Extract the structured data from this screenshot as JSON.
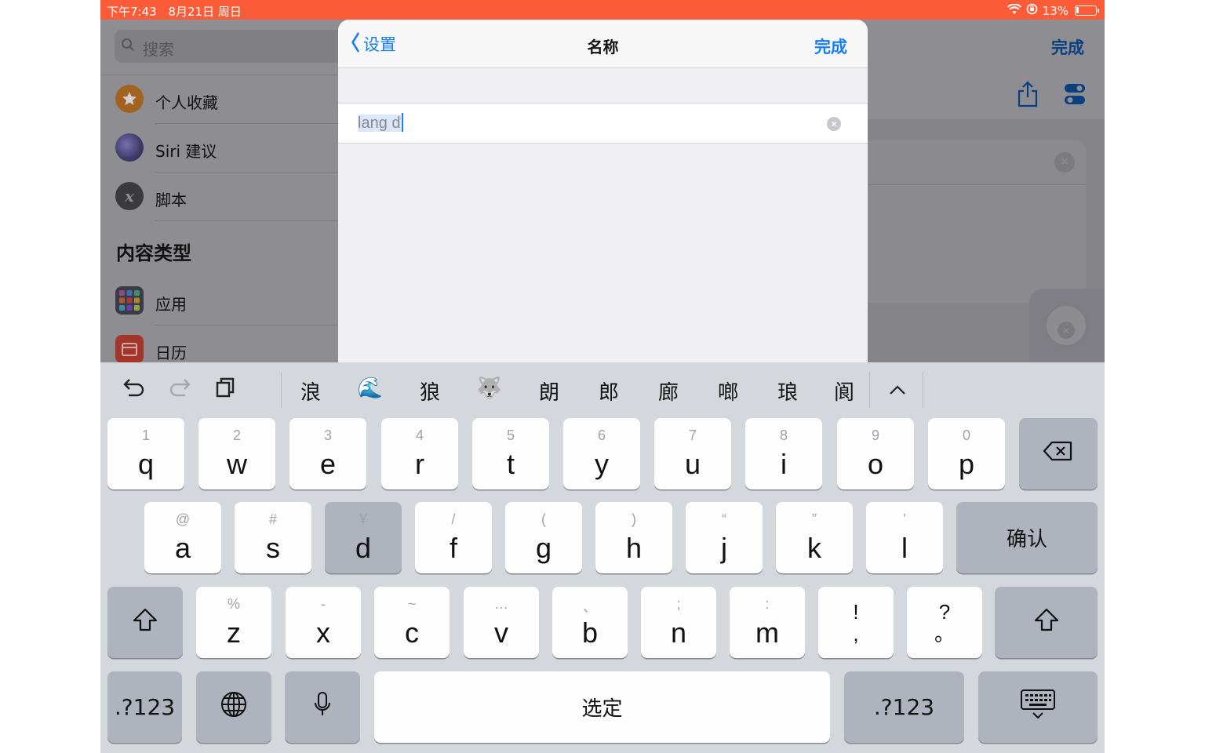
{
  "status_bar": {
    "time": "下午7:43",
    "date": "8月21日 周日",
    "battery": "13%",
    "battery_level": 0.13,
    "color": "#fc5b38"
  },
  "sidebar": {
    "search_placeholder": "搜索",
    "items": [
      {
        "label": "个人收藏",
        "icon": "star-icon"
      },
      {
        "label": "Siri 建议",
        "icon": "siri-icon"
      },
      {
        "label": "脚本",
        "icon": "script-x-icon"
      }
    ],
    "section_title": "内容类型",
    "content_items": [
      {
        "label": "应用",
        "icon": "apps-grid-icon"
      },
      {
        "label": "日历",
        "icon": "calendar-icon"
      }
    ]
  },
  "background": {
    "done_label": "完成"
  },
  "modal": {
    "back_label": "设置",
    "title": "名称",
    "done_label": "完成",
    "input_value": "lang d",
    "accent_color": "#157efb"
  },
  "keyboard": {
    "candidates": [
      "浪",
      "🌊",
      "狼",
      "🐺",
      "朗",
      "郎",
      "廊",
      "啷",
      "琅",
      "阆"
    ],
    "row1": [
      {
        "sub": "1",
        "main": "q"
      },
      {
        "sub": "2",
        "main": "w"
      },
      {
        "sub": "3",
        "main": "e"
      },
      {
        "sub": "4",
        "main": "r"
      },
      {
        "sub": "5",
        "main": "t"
      },
      {
        "sub": "6",
        "main": "y"
      },
      {
        "sub": "7",
        "main": "u"
      },
      {
        "sub": "8",
        "main": "i"
      },
      {
        "sub": "9",
        "main": "o"
      },
      {
        "sub": "0",
        "main": "p"
      }
    ],
    "row2": [
      {
        "sub": "@",
        "main": "a"
      },
      {
        "sub": "#",
        "main": "s"
      },
      {
        "sub": "¥",
        "main": "d"
      },
      {
        "sub": "/",
        "main": "f"
      },
      {
        "sub": "(",
        "main": "g"
      },
      {
        "sub": ")",
        "main": "h"
      },
      {
        "sub": "“",
        "main": "j"
      },
      {
        "sub": "”",
        "main": "k"
      },
      {
        "sub": "’",
        "main": "l"
      }
    ],
    "row3": [
      {
        "sub": "%",
        "main": "z"
      },
      {
        "sub": "-",
        "main": "x"
      },
      {
        "sub": "~",
        "main": "c"
      },
      {
        "sub": "…",
        "main": "v"
      },
      {
        "sub": "、",
        "main": "b"
      },
      {
        "sub": ";",
        "main": "n"
      },
      {
        "sub": ":",
        "main": "m"
      }
    ],
    "row3_punct": [
      {
        "top": "!",
        "bottom": ","
      },
      {
        "top": "?",
        "bottom": "。"
      }
    ],
    "confirm_label": "确认",
    "numbers_label": ".?123",
    "space_label": "选定",
    "pressed_key": "d"
  }
}
